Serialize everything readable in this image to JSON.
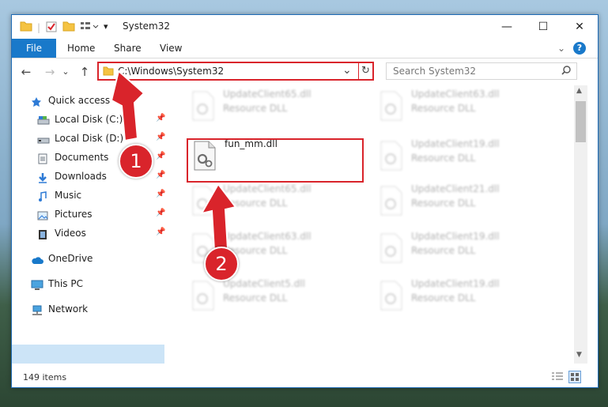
{
  "window": {
    "title": "System32",
    "controls": {
      "minimize": "—",
      "maximize": "☐",
      "close": "✕"
    }
  },
  "ribbon": {
    "tabs": [
      {
        "label": "File"
      },
      {
        "label": "Home"
      },
      {
        "label": "Share"
      },
      {
        "label": "View"
      }
    ],
    "expand_glyph": "⌄",
    "help_glyph": "?"
  },
  "address": {
    "path": "C:\\Windows\\System32",
    "dropdown_glyph": "⌄",
    "refresh_glyph": "↻"
  },
  "search": {
    "placeholder": "Search System32",
    "icon": "search-icon"
  },
  "nav": {
    "back": "←",
    "forward": "→",
    "recent": "⌄",
    "up": "↑"
  },
  "sidebar": {
    "items": [
      {
        "label": "Quick access",
        "icon": "star-icon",
        "pinned": false
      },
      {
        "label": "Local Disk (C:)",
        "icon": "disk-icon",
        "pinned": true
      },
      {
        "label": "Local Disk (D:)",
        "icon": "disk-icon",
        "pinned": true
      },
      {
        "label": "Documents",
        "icon": "documents-icon",
        "pinned": true
      },
      {
        "label": "Downloads",
        "icon": "downloads-icon",
        "pinned": true
      },
      {
        "label": "Music",
        "icon": "music-icon",
        "pinned": true
      },
      {
        "label": "Pictures",
        "icon": "pictures-icon",
        "pinned": true
      },
      {
        "label": "Videos",
        "icon": "videos-icon",
        "pinned": true
      },
      {
        "label": "OneDrive",
        "icon": "cloud-icon",
        "pinned": false
      },
      {
        "label": "This PC",
        "icon": "computer-icon",
        "pinned": false,
        "selected": true
      },
      {
        "label": "Network",
        "icon": "network-icon",
        "pinned": false
      }
    ],
    "pin_glyph": "📌"
  },
  "files": [
    {
      "name": "UpdateClient65.dll",
      "desc": "Resource DLL",
      "blurred": true
    },
    {
      "name": "UpdateClient63.dll",
      "desc": "Resource DLL",
      "blurred": true
    },
    {
      "name": "fun_mm.dll",
      "desc": "",
      "blurred": false
    },
    {
      "name": "UpdateClient19.dll",
      "desc": "Resource DLL",
      "blurred": true
    },
    {
      "name": "UpdateClient65.dll",
      "desc": "Resource DLL",
      "blurred": true
    },
    {
      "name": "UpdateClient21.dll",
      "desc": "Resource DLL",
      "blurred": true
    },
    {
      "name": "UpdateClient63.dll",
      "desc": "Resource DLL",
      "blurred": true
    },
    {
      "name": "UpdateClient19.dll",
      "desc": "Resource DLL",
      "blurred": true
    },
    {
      "name": "UpdateClient5.dll",
      "desc": "Resource DLL",
      "blurred": true
    },
    {
      "name": "UpdateClient19.dll",
      "desc": "Resource DLL",
      "blurred": true
    }
  ],
  "status": {
    "items_count": "149 items"
  },
  "annotations": {
    "step1": "1",
    "step2": "2",
    "color": "#d9242b"
  }
}
